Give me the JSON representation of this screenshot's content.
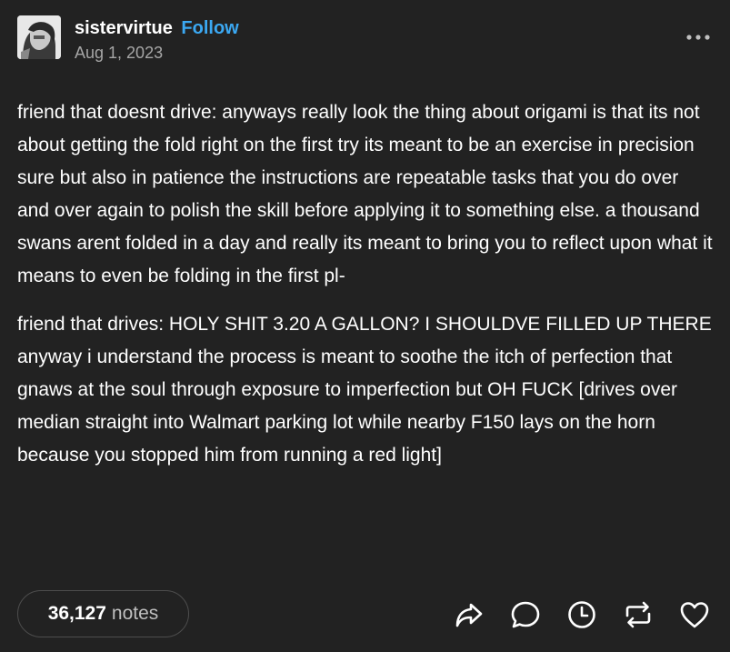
{
  "post": {
    "author": {
      "username": "sistervirtue",
      "follow_label": "Follow",
      "date": "Aug 1, 2023"
    },
    "paragraphs": [
      "friend that doesnt drive: anyways really look the thing about origami is that its not about getting the fold right on the first try its meant to be an exercise in precision sure but also in patience the instructions are repeatable tasks that you do over and over again to polish the skill before applying it to something else. a thousand swans arent folded in a day and really its meant to bring you to reflect upon what it means to even be folding in the first pl-",
      "friend that drives: HOLY SHIT 3.20 A GALLON? I SHOULDVE FILLED UP THERE anyway i understand the process is meant to soothe the itch of perfection that gnaws at the soul through exposure to imperfection but OH FUCK [drives over median straight into Walmart parking lot while nearby F150 lays on the horn because you stopped him from running a red light]"
    ],
    "footer": {
      "notes_count": "36,127",
      "notes_label": "notes",
      "actions": [
        "share-icon",
        "reply-icon",
        "clock-icon",
        "reblog-icon",
        "heart-icon"
      ]
    }
  },
  "colors": {
    "background": "#222222",
    "text": "#ffffff",
    "muted": "#a6a6a6",
    "accent": "#3ba8f2",
    "pill_border": "#4d4d4d"
  }
}
